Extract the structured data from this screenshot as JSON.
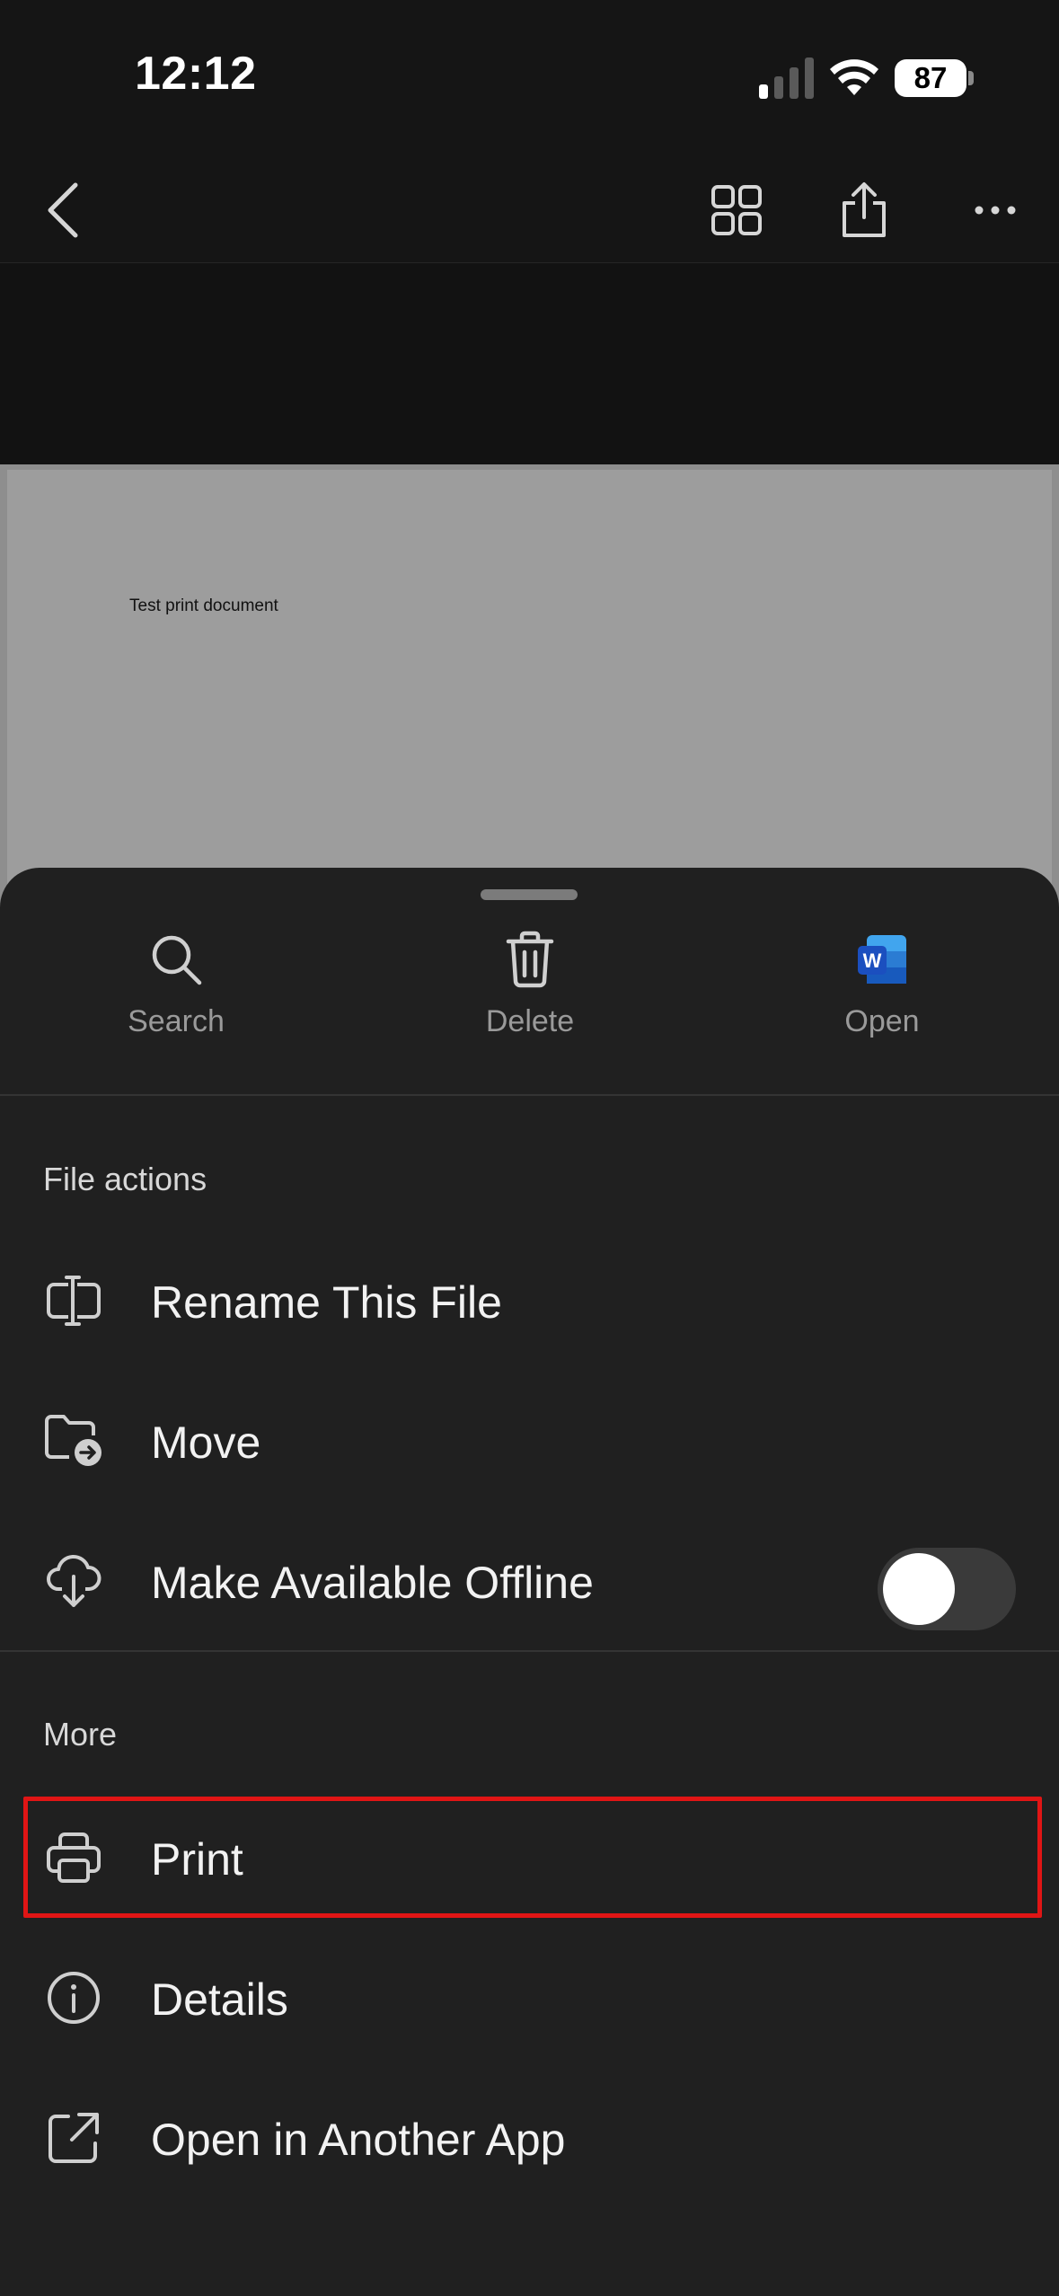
{
  "status_bar": {
    "time": "12:12",
    "battery": "87"
  },
  "toolbar": {
    "icons": [
      "chevron-left-icon",
      "grid-icon",
      "share-icon",
      "ellipsis-icon"
    ]
  },
  "document": {
    "preview_text": "Test print document"
  },
  "quick_actions": [
    {
      "label": "Search",
      "icon": "search-icon"
    },
    {
      "label": "Delete",
      "icon": "trash-icon"
    },
    {
      "label": "Open",
      "icon": "word-app-icon"
    }
  ],
  "file_actions": {
    "header": "File actions",
    "items": [
      {
        "label": "Rename This File",
        "icon": "rename-icon"
      },
      {
        "label": "Move",
        "icon": "folder-move-icon"
      },
      {
        "label": "Make Available Offline",
        "icon": "cloud-download-icon",
        "toggle": false
      }
    ]
  },
  "more": {
    "header": "More",
    "items": [
      {
        "label": "Print",
        "icon": "printer-icon",
        "highlighted": true
      },
      {
        "label": "Details",
        "icon": "info-icon"
      },
      {
        "label": "Open in Another App",
        "icon": "external-open-icon"
      }
    ]
  },
  "colors": {
    "highlight": "#e01515",
    "sheet": "#202020",
    "background": "#151515"
  }
}
